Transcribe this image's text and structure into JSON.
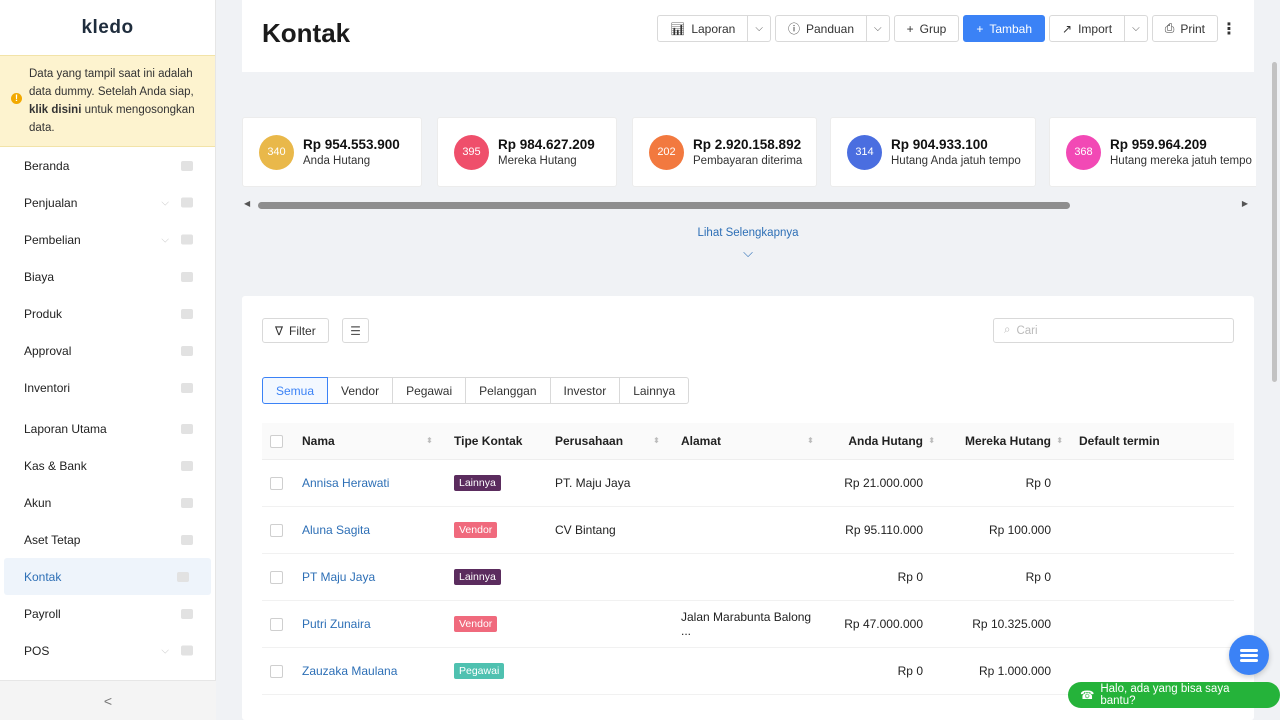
{
  "app": {
    "logo": "kledo"
  },
  "notice": {
    "text_before": "Data yang tampil saat ini adalah data dummy. Setelah Anda siap, ",
    "link": "klik disini",
    "text_after": " untuk mengosongkan data."
  },
  "sidebar": {
    "items": [
      {
        "label": "Beranda",
        "icon": "home-icon",
        "caret": false
      },
      {
        "label": "Penjualan",
        "icon": "bag-icon",
        "caret": true
      },
      {
        "label": "Pembelian",
        "icon": "bag-icon",
        "caret": true
      },
      {
        "label": "Biaya",
        "icon": "card-icon",
        "caret": false
      },
      {
        "label": "Produk",
        "icon": "box-icon",
        "caret": false
      },
      {
        "label": "Approval",
        "icon": "check-icon",
        "caret": false
      },
      {
        "label": "Inventori",
        "icon": "warehouse-icon",
        "caret": false
      },
      {
        "label": "Laporan Utama",
        "icon": "chart-icon",
        "caret": false
      },
      {
        "label": "Kas & Bank",
        "icon": "dollar-icon",
        "caret": false
      },
      {
        "label": "Akun",
        "icon": "ledger-icon",
        "caret": false
      },
      {
        "label": "Aset Tetap",
        "icon": "building-icon",
        "caret": false
      },
      {
        "label": "Kontak",
        "icon": "contact-icon",
        "caret": false,
        "active": true
      },
      {
        "label": "Payroll",
        "icon": "payroll-icon",
        "caret": false
      },
      {
        "label": "POS",
        "icon": "pos-icon",
        "caret": true
      }
    ],
    "collapse": "<"
  },
  "header": {
    "title": "Kontak",
    "buttons": {
      "laporan": "Laporan",
      "panduan": "Panduan",
      "grup": "Grup",
      "tambah": "Tambah",
      "import": "Import",
      "print": "Print"
    }
  },
  "stats": [
    {
      "count": "340",
      "amount": "Rp 954.553.900",
      "label": "Anda Hutang",
      "color": "#e9b84a"
    },
    {
      "count": "395",
      "amount": "Rp 984.627.209",
      "label": "Mereka Hutang",
      "color": "#ef4f6b"
    },
    {
      "count": "202",
      "amount": "Rp 2.920.158.892",
      "label": "Pembayaran diterima",
      "color": "#f2793f"
    },
    {
      "count": "314",
      "amount": "Rp 904.933.100",
      "label": "Hutang Anda jatuh tempo",
      "color": "#4a6ee0"
    },
    {
      "count": "368",
      "amount": "Rp 959.964.209",
      "label": "Hutang mereka jatuh tempo",
      "color": "#f249b5"
    }
  ],
  "see_more": "Lihat Selengkapnya",
  "filters": {
    "filter_label": "Filter",
    "search_placeholder": "Cari"
  },
  "tabs": [
    "Semua",
    "Vendor",
    "Pegawai",
    "Pelanggan",
    "Investor",
    "Lainnya"
  ],
  "table": {
    "headers": [
      "Nama",
      "Tipe Kontak",
      "Perusahaan",
      "Alamat",
      "Anda Hutang",
      "Mereka Hutang",
      "Default termin"
    ],
    "rows": [
      {
        "nama": "Annisa Herawati",
        "tipe": "Lainnya",
        "tipe_color": "#5b2c5e",
        "perusahaan": "PT. Maju Jaya",
        "alamat": "",
        "anda": "Rp 21.000.000",
        "mereka": "Rp 0",
        "termin": ""
      },
      {
        "nama": "Aluna Sagita",
        "tipe": "Vendor",
        "tipe_color": "#f06a7d",
        "perusahaan": "CV Bintang",
        "alamat": "",
        "anda": "Rp 95.110.000",
        "mereka": "Rp 100.000",
        "termin": ""
      },
      {
        "nama": "PT Maju Jaya",
        "tipe": "Lainnya",
        "tipe_color": "#5b2c5e",
        "perusahaan": "",
        "alamat": "",
        "anda": "Rp 0",
        "mereka": "Rp 0",
        "termin": ""
      },
      {
        "nama": "Putri Zunaira",
        "tipe": "Vendor",
        "tipe_color": "#f06a7d",
        "perusahaan": "",
        "alamat": "Jalan Marabunta Balong ...",
        "anda": "Rp 47.000.000",
        "mereka": "Rp 10.325.000",
        "termin": ""
      },
      {
        "nama": "Zauzaka Maulana",
        "tipe": "Pegawai",
        "tipe_color": "#4fc1b0",
        "perusahaan": "",
        "alamat": "",
        "anda": "Rp 0",
        "mereka": "Rp 1.000.000",
        "termin": ""
      }
    ]
  },
  "chat": {
    "whatsapp": "Halo, ada yang bisa saya bantu?"
  }
}
